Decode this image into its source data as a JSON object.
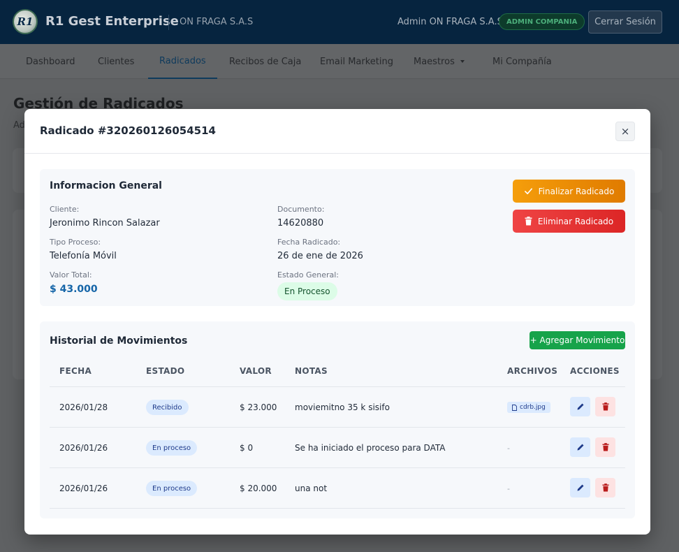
{
  "header": {
    "logo_text": "R1",
    "brand": "R1 Gest Enterprise",
    "company": "ON FRAGA S.A.S",
    "user": "Admin ON FRAGA S.A.S",
    "role_badge": "ADMIN COMPANIA",
    "logout_label": "Cerrar Sesión"
  },
  "nav": {
    "items": [
      {
        "label": "Dashboard"
      },
      {
        "label": "Clientes"
      },
      {
        "label": "Radicados",
        "active": true
      },
      {
        "label": "Recibos de Caja"
      },
      {
        "label": "Email Marketing"
      },
      {
        "label": "Maestros",
        "has_dropdown": true
      },
      {
        "label": "Mi Compañía"
      }
    ]
  },
  "page": {
    "title": "Gestión de Radicados",
    "subtitle": "Ad"
  },
  "modal": {
    "title": "Radicado #320260126054514",
    "close_label": "×",
    "info": {
      "section_title": "Informacion General",
      "cliente_label": "Cliente:",
      "cliente": "Jeronimo Rincon Salazar",
      "documento_label": "Documento:",
      "documento": "14620880",
      "tipo_label": "Tipo Proceso:",
      "tipo": "Telefonía Móvil",
      "fecha_label": "Fecha Radicado:",
      "fecha": "26 de ene de 2026",
      "valor_label": "Valor Total:",
      "valor": "$ 43.000",
      "estado_label": "Estado General:",
      "estado": "En Proceso",
      "finalize_label": "Finalizar Radicado",
      "delete_label": "Eliminar Radicado"
    },
    "history": {
      "section_title": "Historial de Movimientos",
      "add_label": "+ Agregar Movimiento",
      "columns": [
        "FECHA",
        "ESTADO",
        "VALOR",
        "NOTAS",
        "ARCHIVOS",
        "ACCIONES"
      ],
      "rows": [
        {
          "fecha": "2026/01/28",
          "estado": "Recibido",
          "valor": "$ 23.000",
          "notas": "moviemitno 35 k sisifo",
          "archivo": "cdrb.jpg"
        },
        {
          "fecha": "2026/01/26",
          "estado": "En proceso",
          "valor": "$ 0",
          "notas": "Se ha iniciado el proceso para DATA",
          "archivo": "-"
        },
        {
          "fecha": "2026/01/26",
          "estado": "En proceso",
          "valor": "$ 20.000",
          "notas": "una not",
          "archivo": "-"
        }
      ]
    }
  },
  "colors": {
    "header_bg": "#06243f",
    "accent_blue": "#1565a8",
    "finalize": "#f59e0b",
    "delete": "#ef4444",
    "add": "#16a34a"
  }
}
